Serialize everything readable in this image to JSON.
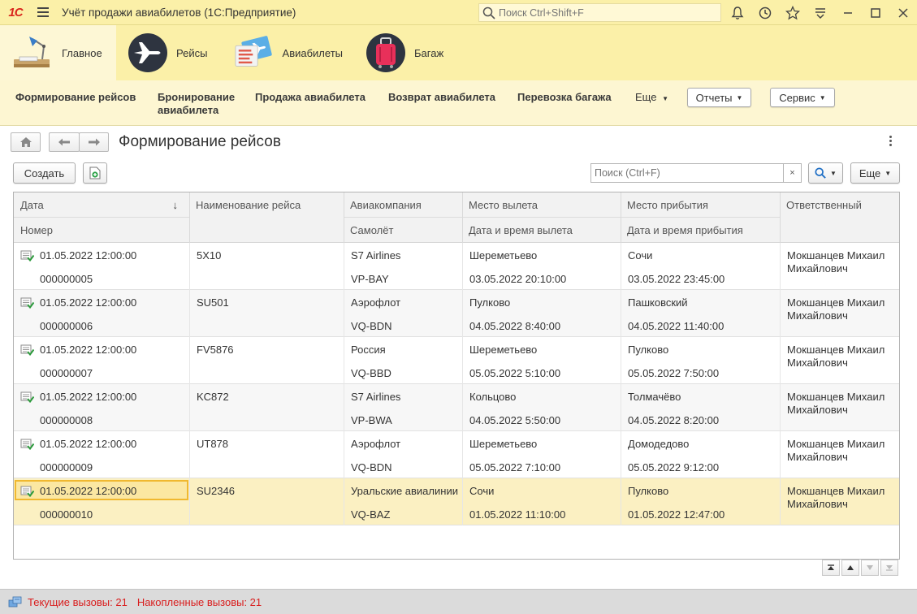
{
  "app": {
    "title": "Учёт продажи авиабилетов  (1С:Предприятие)",
    "logo_text": "1С",
    "search_placeholder": "Поиск Ctrl+Shift+F",
    "accent_color": "#fbf0a8"
  },
  "title_icons": [
    "bell-icon",
    "history-icon",
    "star-icon",
    "menu-more-icon",
    "minimize-icon",
    "maximize-icon",
    "close-icon"
  ],
  "sections": [
    {
      "label": "Главное",
      "icon": "desk-lamp-icon",
      "active": true
    },
    {
      "label": "Рейсы",
      "icon": "airplane-icon",
      "active": false
    },
    {
      "label": "Авиабилеты",
      "icon": "tickets-icon",
      "active": false
    },
    {
      "label": "Багаж",
      "icon": "suitcase-icon",
      "active": false
    }
  ],
  "function_panel": {
    "items": [
      "Формирование рейсов",
      "Бронирование авиабилета",
      "Продажа авиабилета",
      "Возврат авиабилета",
      "Перевозка багажа"
    ],
    "more_label": "Еще",
    "reports_label": "Отчеты",
    "service_label": "Сервис"
  },
  "form": {
    "title": "Формирование рейсов",
    "create_label": "Создать",
    "search_placeholder": "Поиск (Ctrl+F)",
    "more_label": "Еще",
    "clear_label": "×"
  },
  "table": {
    "headers": {
      "date": "Дата",
      "number": "Номер",
      "flight_name": "Наименование рейса",
      "airline": "Авиакомпания",
      "plane": "Самолёт",
      "departure_place": "Место вылета",
      "departure_time": "Дата и время вылета",
      "arrival_place": "Место прибытия",
      "arrival_time": "Дата и время прибытия",
      "responsible": "Ответственный"
    },
    "sort_indicator": "↓",
    "rows": [
      {
        "date": "01.05.2022 12:00:00",
        "number": "000000005",
        "flight_name": "5Х10",
        "airline": "S7 Airlines",
        "plane": "VP-BAY",
        "departure_place": "Шереметьево",
        "departure_time": "03.05.2022 20:10:00",
        "arrival_place": "Сочи",
        "arrival_time": "03.05.2022 23:45:00",
        "responsible": "Мокшанцев Михаил Михайлович"
      },
      {
        "date": "01.05.2022 12:00:00",
        "number": "000000006",
        "flight_name": "SU501",
        "airline": "Аэрофлот",
        "plane": "VQ-BDN",
        "departure_place": "Пулково",
        "departure_time": "04.05.2022 8:40:00",
        "arrival_place": "Пашковский",
        "arrival_time": "04.05.2022 11:40:00",
        "responsible": "Мокшанцев Михаил Михайлович"
      },
      {
        "date": "01.05.2022 12:00:00",
        "number": "000000007",
        "flight_name": "FV5876",
        "airline": "Россия",
        "plane": "VQ-BBD",
        "departure_place": "Шереметьево",
        "departure_time": "05.05.2022 5:10:00",
        "arrival_place": "Пулково",
        "arrival_time": "05.05.2022 7:50:00",
        "responsible": "Мокшанцев Михаил Михайлович"
      },
      {
        "date": "01.05.2022 12:00:00",
        "number": "000000008",
        "flight_name": "KC872",
        "airline": "S7 Airlines",
        "plane": "VP-BWA",
        "departure_place": "Кольцово",
        "departure_time": "04.05.2022 5:50:00",
        "arrival_place": "Толмачёво",
        "arrival_time": "04.05.2022 8:20:00",
        "responsible": "Мокшанцев Михаил Михайлович"
      },
      {
        "date": "01.05.2022 12:00:00",
        "number": "000000009",
        "flight_name": "UT878",
        "airline": "Аэрофлот",
        "plane": "VQ-BDN",
        "departure_place": "Шереметьево",
        "departure_time": "05.05.2022 7:10:00",
        "arrival_place": "Домодедово",
        "arrival_time": "05.05.2022 9:12:00",
        "responsible": "Мокшанцев Михаил Михайлович"
      },
      {
        "date": "01.05.2022 12:00:00",
        "number": "000000010",
        "flight_name": "SU2346",
        "airline": "Уральские авиалинии",
        "plane": "VQ-BAZ",
        "departure_place": "Сочи",
        "departure_time": "01.05.2022 11:10:00",
        "arrival_place": "Пулково",
        "arrival_time": "01.05.2022 12:47:00",
        "responsible": "Мокшанцев Михаил Михайлович",
        "selected": true
      }
    ]
  },
  "status": {
    "current_calls": "Текущие вызовы: 21",
    "accumulated_calls": "Накопленные вызовы: 21",
    "color": "#d91e1e"
  }
}
